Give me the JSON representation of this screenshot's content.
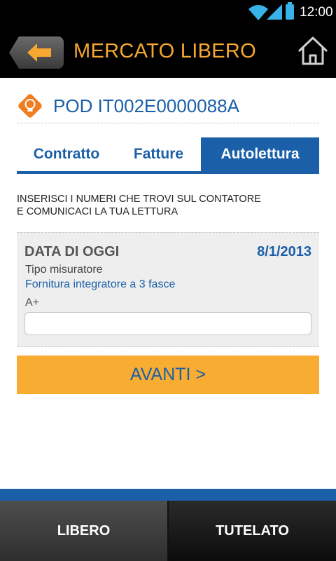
{
  "status_bar": {
    "time": "12:00",
    "icons": [
      "wifi-icon",
      "signal-icon",
      "battery-icon"
    ]
  },
  "header": {
    "title": "MERCATO LIBERO",
    "back_icon": "back-arrow-icon",
    "home_icon": "home-icon"
  },
  "pod": {
    "label": "POD IT002E0000088A",
    "icon": "lightbulb-icon"
  },
  "tabs": [
    {
      "label": "Contratto",
      "selected": false
    },
    {
      "label": "Fatture",
      "selected": false
    },
    {
      "label": "Autolettura",
      "selected": true
    }
  ],
  "instructions": {
    "line1": "INSERISCI I NUMERI CHE TROVI SUL CONTATORE",
    "line2": "E COMUNICACI LA TUA LETTURA"
  },
  "form": {
    "date_label": "DATA DI OGGI",
    "date_value": "8/1/2013",
    "meter_label": "Tipo misuratore",
    "meter_value": "Fornitura integratore a 3 fasce",
    "field_label": "A+",
    "field_value": ""
  },
  "next_button": {
    "label": "AVANTI >"
  },
  "bottom_tabs": [
    {
      "label": "LIBERO",
      "selected": true
    },
    {
      "label": "TUTELATO",
      "selected": false
    }
  ],
  "colors": {
    "brand_blue": "#1a5fa8",
    "accent_orange": "#f9ac32",
    "title_orange": "#f7a831"
  }
}
